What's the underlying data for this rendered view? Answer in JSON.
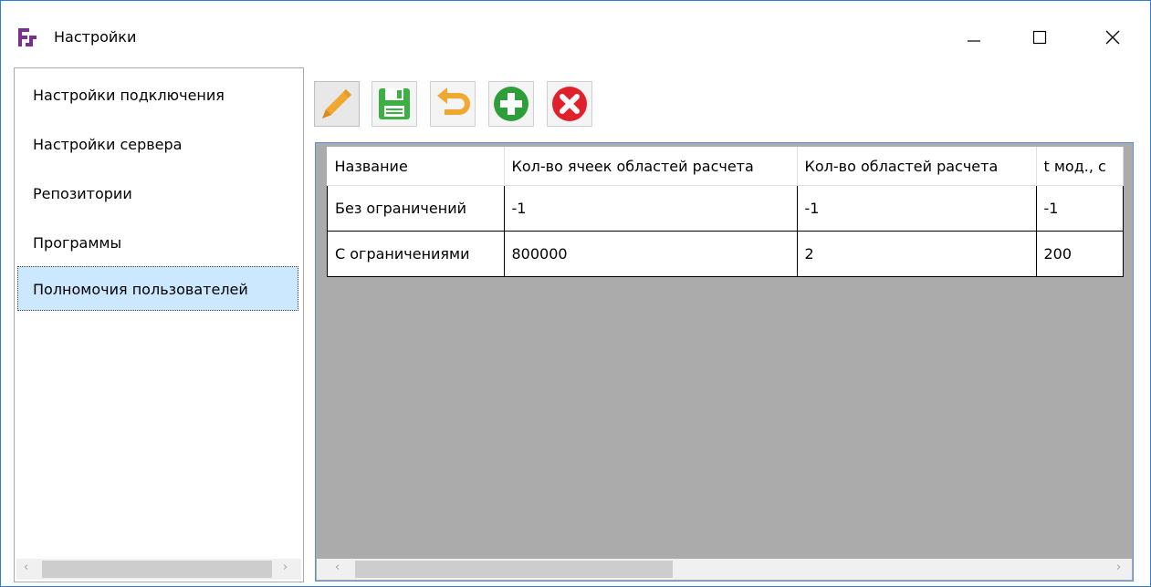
{
  "window": {
    "title": "Настройки"
  },
  "nav": {
    "items": [
      {
        "label": "Настройки подключения"
      },
      {
        "label": "Настройки сервера"
      },
      {
        "label": "Репозитории"
      },
      {
        "label": "Программы"
      },
      {
        "label": "Полномочия пользователей"
      }
    ],
    "selected_index": 4
  },
  "toolbar": {
    "buttons": [
      {
        "icon": "pencil-icon",
        "color": "#f0a830"
      },
      {
        "icon": "save-icon",
        "color": "#3cb043"
      },
      {
        "icon": "undo-icon",
        "color": "#f0a830"
      },
      {
        "icon": "add-icon",
        "color": "#2e9e3a"
      },
      {
        "icon": "delete-icon",
        "color": "#e0202a"
      }
    ]
  },
  "table": {
    "columns": [
      "Название",
      "Кол-во ячеек областей расчета",
      "Кол-во областей расчета",
      "t мод., с"
    ],
    "rows": [
      [
        "Без ограничений",
        "-1",
        "-1",
        "-1"
      ],
      [
        "С ограничениями",
        "800000",
        "2",
        "200"
      ]
    ]
  },
  "scroll_arrows": {
    "left": "‹",
    "right": "›"
  }
}
